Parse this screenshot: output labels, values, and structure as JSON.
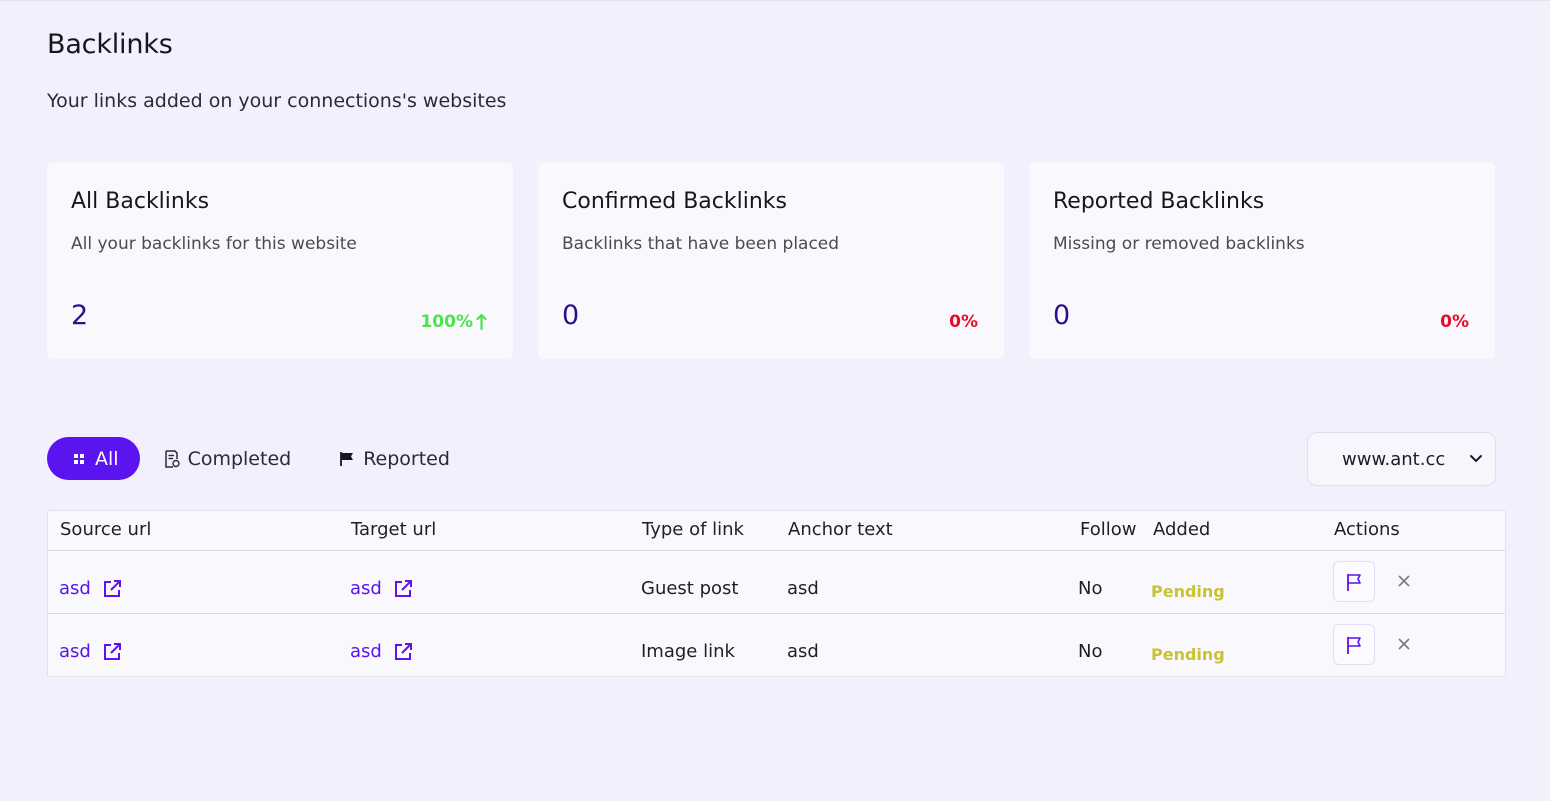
{
  "header": {
    "title": "Backlinks",
    "subtitle": "Your links added on your connections's websites"
  },
  "cards": [
    {
      "title": "All Backlinks",
      "description": "All your backlinks for this website",
      "count": "2",
      "percent": "100%",
      "trend": "up",
      "color": "#4ee24e"
    },
    {
      "title": "Confirmed Backlinks",
      "description": "Backlinks that have been placed",
      "count": "0",
      "percent": "0%",
      "trend": "none",
      "color": "#e0102a"
    },
    {
      "title": "Reported Backlinks",
      "description": "Missing or removed backlinks",
      "count": "0",
      "percent": "0%",
      "trend": "none",
      "color": "#e0102a"
    }
  ],
  "filters": {
    "all": {
      "label": "All",
      "icon": "grid-icon",
      "active": true
    },
    "completed": {
      "label": "Completed",
      "icon": "document-check-icon"
    },
    "reported": {
      "label": "Reported",
      "icon": "flag-icon"
    }
  },
  "site_select": {
    "value": "www.ant.cc"
  },
  "table": {
    "columns": {
      "source": "Source url",
      "target": "Target url",
      "type": "Type of link",
      "anchor": "Anchor text",
      "follow": "Follow",
      "added": "Added",
      "actions": "Actions"
    },
    "rows": [
      {
        "source": "asd",
        "target": "asd",
        "type": "Guest post",
        "anchor": "asd",
        "follow": "No",
        "added": "Pending"
      },
      {
        "source": "asd",
        "target": "asd",
        "type": "Image link",
        "anchor": "asd",
        "follow": "No",
        "added": "Pending"
      }
    ]
  },
  "colors": {
    "accent": "#5b13f0",
    "count": "#2e0f8c",
    "pending": "#c9c232",
    "positive": "#4ee24e",
    "negative": "#e0102a"
  }
}
